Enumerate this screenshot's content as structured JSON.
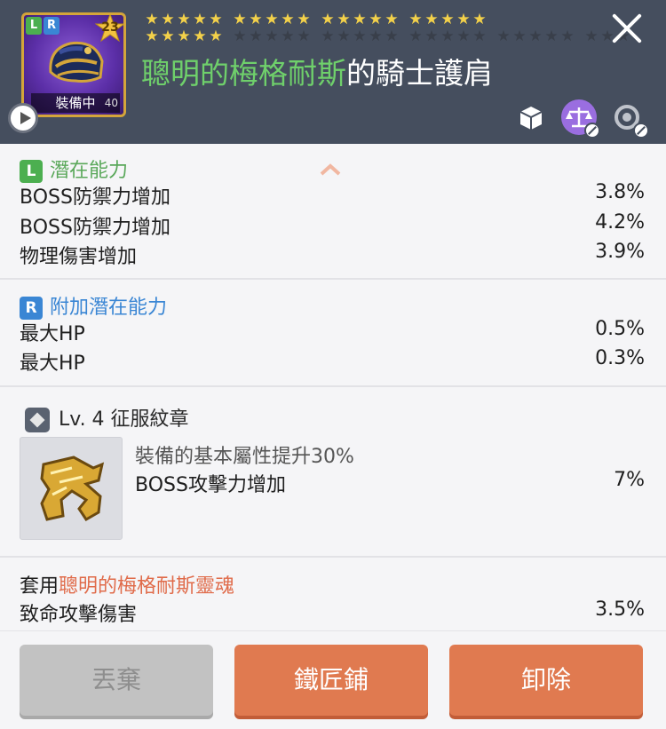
{
  "header": {
    "item_icon": "shoulder-armor-icon",
    "level": "23",
    "equipped_label": "裝備中",
    "small_number": "40",
    "potential_badges": [
      "L",
      "R"
    ],
    "stars_filled": 25,
    "stars_total": 48,
    "name_prefix": "聰明的梅格耐斯",
    "name_suffix": "的騎士護肩",
    "icons": [
      "lock-box-icon",
      "scale-icon",
      "reset-icon"
    ]
  },
  "potential": {
    "badge": "L",
    "title": "潛在能力",
    "stats": [
      {
        "name": "BOSS防禦力增加",
        "value": "3.8%"
      },
      {
        "name": "BOSS防禦力增加",
        "value": "4.2%"
      },
      {
        "name": "物理傷害增加",
        "value": "3.9%"
      }
    ]
  },
  "additional_potential": {
    "badge": "R",
    "title": "附加潛在能力",
    "stats": [
      {
        "name": "最大HP",
        "value": "0.5%"
      },
      {
        "name": "最大HP",
        "value": "0.3%"
      }
    ]
  },
  "emblem": {
    "title": "Lv. 4 征服紋章",
    "description": "裝備的基本屬性提升30%",
    "stat_name": "BOSS攻擊力增加",
    "stat_value": "7%"
  },
  "set_effect": {
    "prefix": "套用",
    "name": "聰明的梅格耐斯靈魂",
    "stat_name": "致命攻擊傷害",
    "stat_value": "3.5%"
  },
  "buttons": {
    "discard": "丟棄",
    "blacksmith": "鐵匠鋪",
    "remove": "卸除"
  },
  "colors": {
    "header_bg": "#454e5e",
    "legendary_green": "#4caf50",
    "rare_blue": "#3a86d4",
    "accent_orange": "#e07a50"
  }
}
